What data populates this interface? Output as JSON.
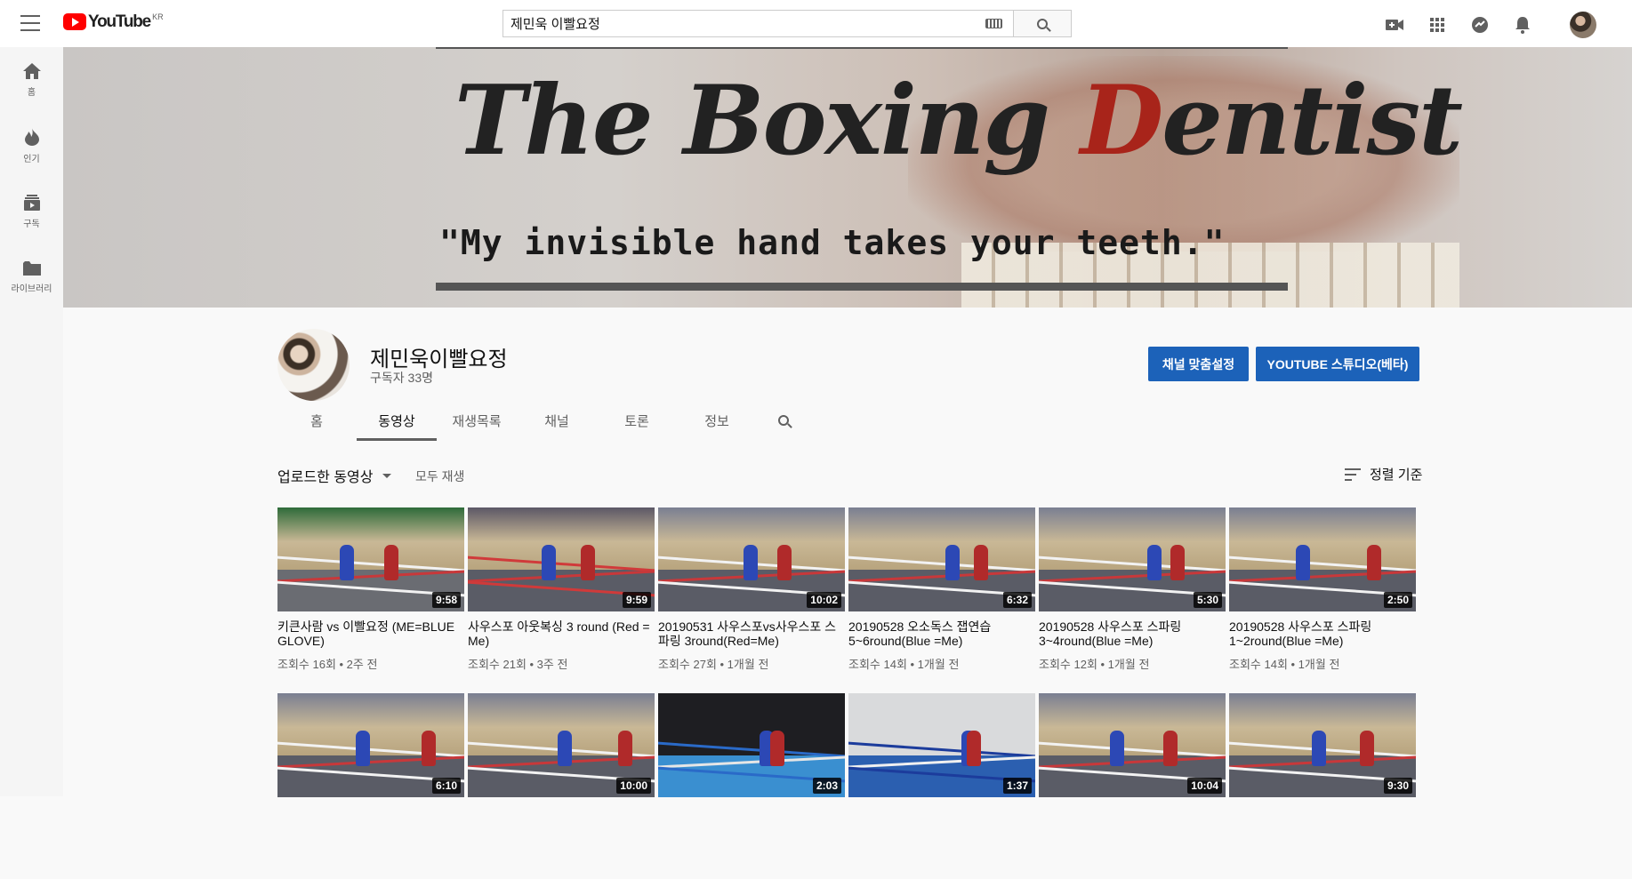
{
  "topbar": {
    "logo_text": "YouTube",
    "logo_country": "KR",
    "search_value": "제민욱 이빨요정",
    "icons": [
      "create-video-icon",
      "apps-icon",
      "messages-icon",
      "notifications-icon"
    ]
  },
  "sidebar": {
    "items": [
      {
        "label": "홈",
        "icon": "home-icon"
      },
      {
        "label": "인기",
        "icon": "trending-icon"
      },
      {
        "label": "구독",
        "icon": "subscriptions-icon"
      },
      {
        "label": "라이브러리",
        "icon": "library-icon"
      }
    ]
  },
  "banner": {
    "title_part1": "The Boxing ",
    "title_highlight": "D",
    "title_part2": "entist",
    "tagline": "\"My invisible hand takes your teeth.\"",
    "accent_color": "#a8241a"
  },
  "channel": {
    "name": "제민욱이빨요정",
    "subscribers": "구독자 33명",
    "customize_button": "채널 맞춤설정",
    "studio_button": "YOUTUBE 스튜디오(베타)",
    "button_color": "#1c62b9"
  },
  "tabs": [
    {
      "label": "홈",
      "active": false
    },
    {
      "label": "동영상",
      "active": true
    },
    {
      "label": "재생목록",
      "active": false
    },
    {
      "label": "채널",
      "active": false
    },
    {
      "label": "토론",
      "active": false
    },
    {
      "label": "정보",
      "active": false
    }
  ],
  "filter": {
    "label": "업로드한 동영상",
    "play_all": "모두 재생",
    "sort_label": "정렬 기준"
  },
  "videos": [
    {
      "title": "키큰사람 vs 이빨요정 (ME=BLUE GLOVE)",
      "meta": "조회수 16회 • 2주 전",
      "duration": "9:58",
      "scene": "green"
    },
    {
      "title": "사우스포 아웃복싱 3 round (Red = Me)",
      "meta": "조회수 21회 • 3주 전",
      "duration": "9:59",
      "scene": "red"
    },
    {
      "title": "20190531 사우스포vs사우스포 스파링 3round(Red=Me)",
      "meta": "조회수 27회 • 1개월 전",
      "duration": "10:02",
      "scene": "gym"
    },
    {
      "title": "20190528 오소독스 잽연습 5~6round(Blue =Me)",
      "meta": "조회수 14회 • 1개월 전",
      "duration": "6:32",
      "scene": "gym"
    },
    {
      "title": "20190528 사우스포 스파링 3~4round(Blue =Me)",
      "meta": "조회수 12회 • 1개월 전",
      "duration": "5:30",
      "scene": "gym"
    },
    {
      "title": "20190528 사우스포 스파링 1~2round(Blue =Me)",
      "meta": "조회수 14회 • 1개월 전",
      "duration": "2:50",
      "scene": "gym"
    },
    {
      "title": "",
      "meta": "",
      "duration": "6:10",
      "scene": "gym"
    },
    {
      "title": "",
      "meta": "",
      "duration": "10:00",
      "scene": "gym"
    },
    {
      "title": "",
      "meta": "",
      "duration": "2:03",
      "scene": "festival"
    },
    {
      "title": "",
      "meta": "",
      "duration": "1:37",
      "scene": "festival2"
    },
    {
      "title": "",
      "meta": "",
      "duration": "10:04",
      "scene": "gym"
    },
    {
      "title": "",
      "meta": "",
      "duration": "9:30",
      "scene": "gym"
    }
  ]
}
